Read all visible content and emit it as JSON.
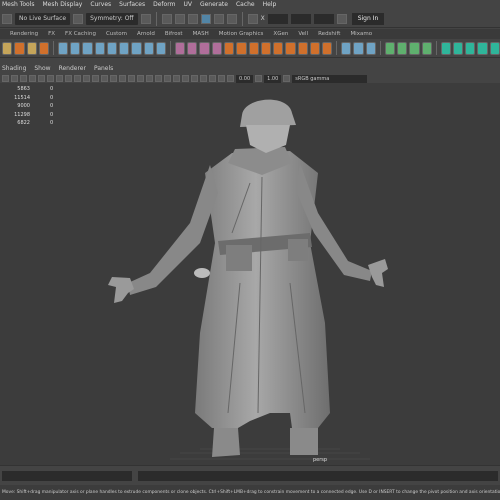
{
  "menubar": [
    "Mesh Tools",
    "Mesh Display",
    "Curves",
    "Surfaces",
    "Deform",
    "UV",
    "Generate",
    "Cache",
    "Help"
  ],
  "statusline": {
    "live_surface": "No Live Surface",
    "symmetry": "Symmetry: Off",
    "x_label": "X",
    "signin": "Sign In"
  },
  "shelf_tabs": [
    "Rendering",
    "FX",
    "FX Caching",
    "Custom",
    "Arnold",
    "Bifrost",
    "MASH",
    "Motion Graphics",
    "XGen",
    "Vell",
    "Redshift",
    "Mixamo"
  ],
  "panel_menu": [
    "Shading",
    "Show",
    "Renderer",
    "Panels"
  ],
  "panel_tools": {
    "exposure": "0.00",
    "gamma_value": "1.00",
    "colorspace": "sRGB gamma"
  },
  "hud": {
    "rows": [
      {
        "a": "5863",
        "b": "0"
      },
      {
        "a": "11514",
        "b": "0"
      },
      {
        "a": "9000",
        "b": "0"
      },
      {
        "a": "11298",
        "b": "0"
      },
      {
        "a": "6822",
        "b": "0"
      }
    ]
  },
  "camera_label": "persp",
  "help_line": "Move: Shift+drag manipulator axis or plane handles to extrude components or clone objects. Ctrl+Shift+LMB+drag to constrain movement to a connected edge. Use D or INSERT to change the pivot position and axis orientation."
}
